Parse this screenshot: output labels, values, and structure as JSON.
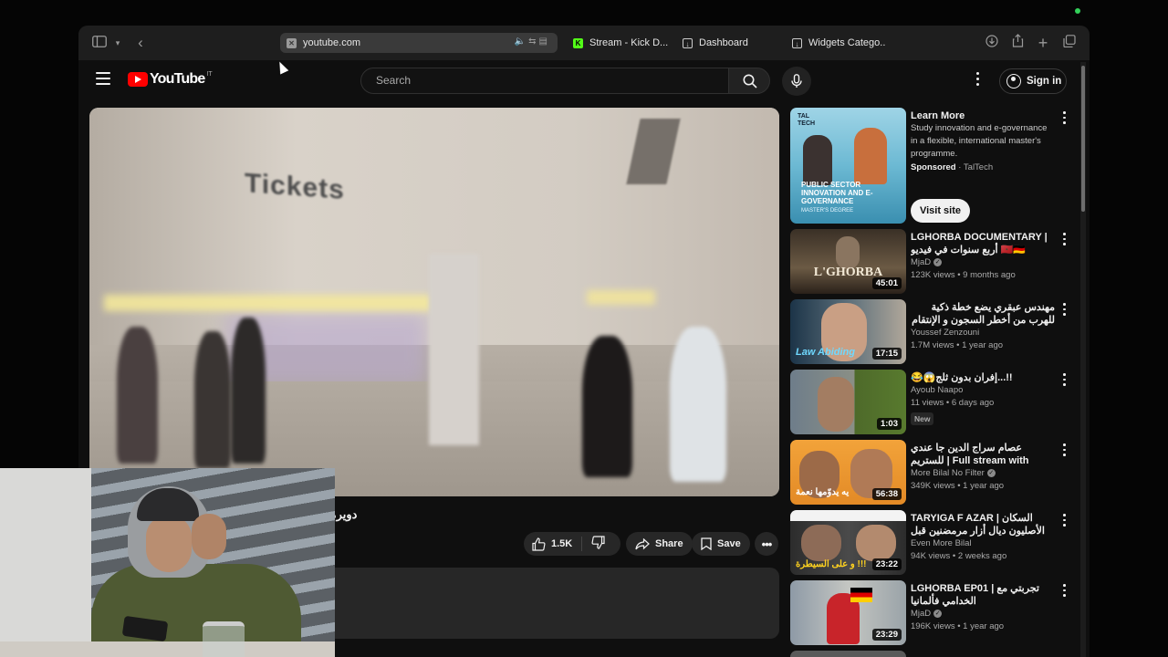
{
  "browser": {
    "address": "youtube.com",
    "tabs": [
      {
        "label": "Stream - Kick D...",
        "favicon": "kick-icon"
      },
      {
        "label": "Dashboard",
        "favicon": "download-box-icon"
      },
      {
        "label": "Widgets Catego...",
        "favicon": "download-box-icon"
      }
    ]
  },
  "youtube": {
    "logo_text": "YouTube",
    "country_code": "IT",
    "search_placeholder": "Search",
    "sign_in": "Sign in"
  },
  "video": {
    "sign_text": "Tickets",
    "title": "دويرة فا"
  },
  "actions": {
    "like_count": "1.5K",
    "share": "Share",
    "save": "Save"
  },
  "sidebar": {
    "ad": {
      "thumb_brand": "TAL TECH",
      "thumb_title": "PUBLIC SECTOR INNOVATION AND E-GOVERNANCE",
      "thumb_sub": "MASTER'S DEGREE",
      "title": "Learn More",
      "body": "Study innovation and e-governance in a flexible, international master's programme.",
      "sponsored": "Sponsored",
      "advertiser": "TalTech",
      "cta": "Visit site"
    },
    "videos": [
      {
        "title": "LGHORBA DOCUMENTARY | أربع سنوات في فيديو 🇲🇦🇩🇪",
        "channel": "MjaD",
        "stats": "123K views • 9 months ago",
        "duration": "45:01",
        "thumb_text": "L'GHORBA",
        "verified": true
      },
      {
        "title": "مهندس عبقري يضع خطة ذكية للهرب من أخطر السجون و الإنتقام من قاتل إبنته😱...",
        "channel": "Youssef Zenzouni",
        "stats": "1.7M views • 1 year ago",
        "duration": "17:15",
        "thumb_text": "Law Abiding",
        "verified": false
      },
      {
        "title": "😂😱إفران بدون ثلج...!!",
        "channel": "Ayoub Naapo",
        "stats": "11 views • 6 days ago",
        "duration": "1:03",
        "badge": "New",
        "verified": false
      },
      {
        "title": "عصام سراج الدين جا عندي للستريم | Full stream with issam siraj eddine",
        "channel": "More Bilal No Filter",
        "stats": "349K views • 1 year ago",
        "duration": "56:38",
        "thumb_text": "يه يدوّمها نعمة",
        "verified": true
      },
      {
        "title": "TARYIGA F AZAR | السكان الأصليون ديال أزار مرمضنين قبل الفطور",
        "channel": "Even More Bilal",
        "stats": "94K views • 2 weeks ago",
        "duration": "23:22",
        "thumb_text": "و على السيطرة !!!",
        "verified": false
      },
      {
        "title": "LGHORBA EP01 | تجربتي مع الخدامي فألمانيا",
        "channel": "MjaD",
        "stats": "196K views • 1 year ago",
        "duration": "23:29",
        "verified": true
      }
    ]
  },
  "colors": {
    "yt_red": "#ff0000",
    "bg": "#0f0f0f",
    "pill": "#272727",
    "kick_green": "#53fc18"
  }
}
